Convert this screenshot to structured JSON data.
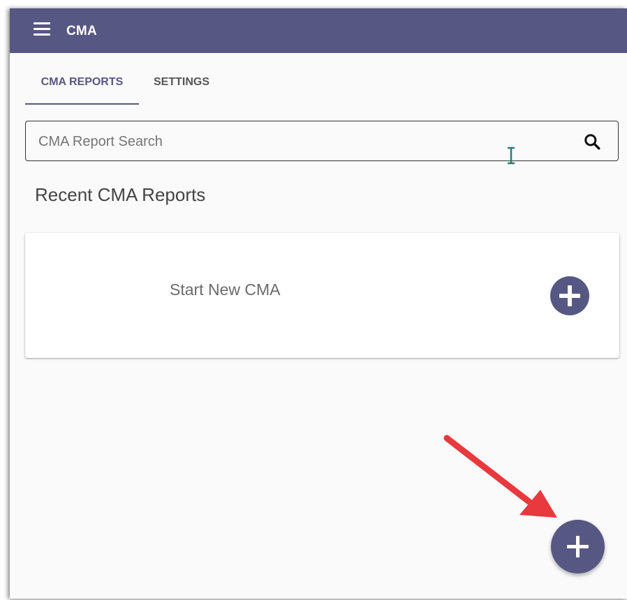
{
  "app": {
    "title": "CMA"
  },
  "tabs": [
    {
      "label": "CMA REPORTS",
      "active": true
    },
    {
      "label": "SETTINGS",
      "active": false
    }
  ],
  "search": {
    "placeholder": "CMA Report Search",
    "value": ""
  },
  "recent": {
    "title": "Recent CMA Reports"
  },
  "card": {
    "label": "Start New CMA"
  },
  "icons": {
    "menu": "hamburger-menu-icon",
    "search": "search-icon",
    "add": "plus-circle-icon",
    "fab": "plus-icon",
    "annotation": "red-arrow-icon",
    "cursor": "text-cursor-icon"
  },
  "colors": {
    "primary": "#575784",
    "background": "#fafafa",
    "card": "#ffffff",
    "annotation": "#e8393e",
    "cursor": "#2a7a7a"
  }
}
